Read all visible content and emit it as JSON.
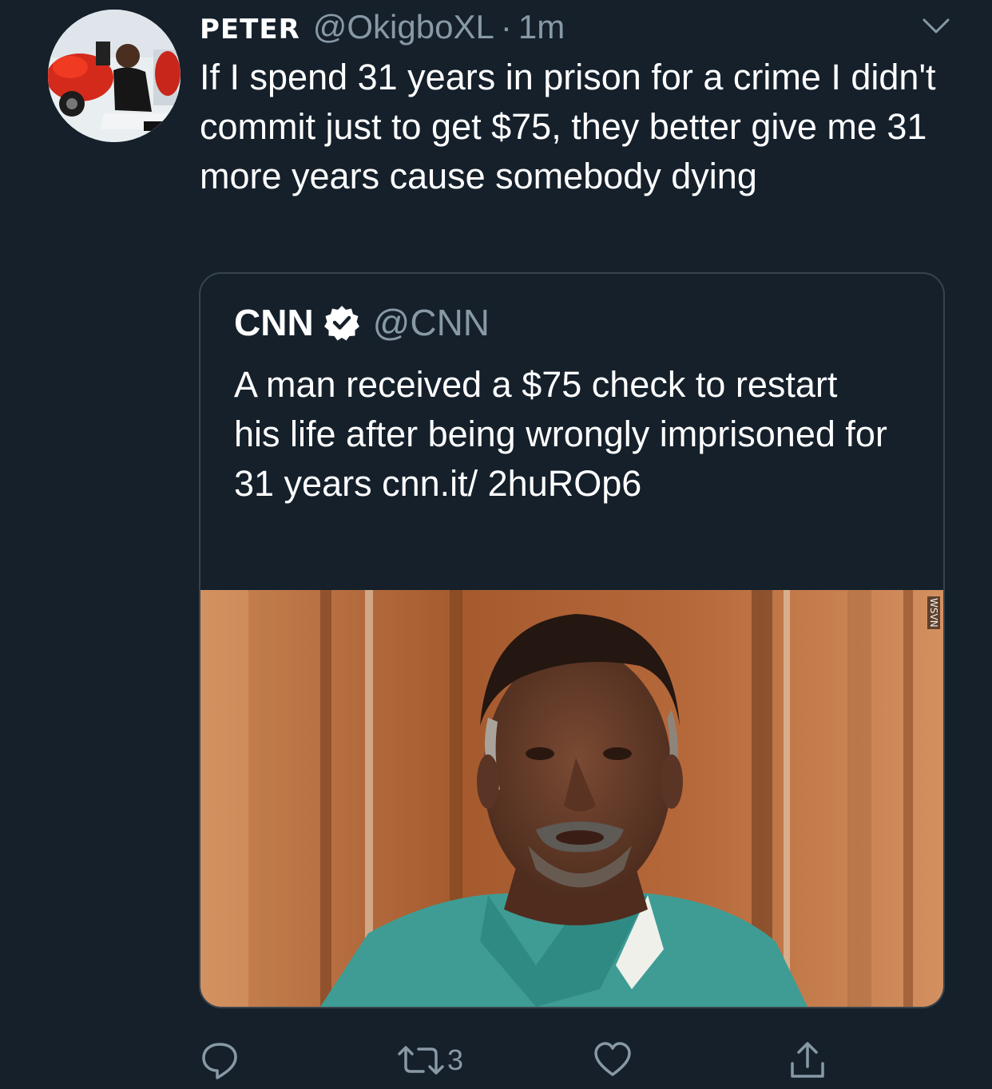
{
  "tweet": {
    "display_name": "PETER",
    "handle": "@OkigboXL",
    "separator": "·",
    "time": "1m",
    "text": "If I spend 31 years in prison for a crime I didn't commit just to get $75, they better give me 31 more years cause somebody dying"
  },
  "quote": {
    "name": "CNN",
    "handle": "@CNN",
    "text": "A man received a $75 check to restart his life after being wrongly imprisoned for 31 years cnn.it/ 2huROp6",
    "media_watermark": "WSVN"
  },
  "actions": {
    "retweet_count": "3"
  },
  "icons": {
    "caret": "chevron-down-icon",
    "verified": "verified-badge-icon",
    "reply": "reply-icon",
    "retweet": "retweet-icon",
    "like": "heart-icon",
    "share": "share-icon"
  },
  "colors": {
    "background": "#15202b",
    "secondary_text": "#8899a6",
    "border": "#38444d"
  }
}
